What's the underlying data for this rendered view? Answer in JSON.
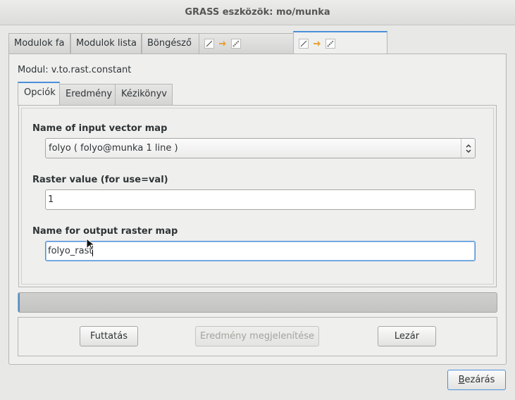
{
  "window": {
    "title": "GRASS eszközök: mo/munka"
  },
  "outer_tabs": [
    {
      "label": "Modulok fa"
    },
    {
      "label": "Modulok lista"
    },
    {
      "label": "Böngésző"
    }
  ],
  "module": {
    "label": "Modul: v.to.rast.constant"
  },
  "inner_tabs": [
    {
      "label": "Opciók"
    },
    {
      "label": "Eredmény"
    },
    {
      "label": "Kézikönyv"
    }
  ],
  "form": {
    "input_map": {
      "label": "Name of input vector map",
      "value": "folyo ( folyo@munka 1 line )"
    },
    "raster_value": {
      "label": "Raster value (for use=val)",
      "value": "1"
    },
    "output_map": {
      "label": "Name for output raster map",
      "value": "folyo_rast"
    }
  },
  "progress": {
    "value_percent": 0
  },
  "buttons": {
    "run": "Futtatás",
    "show_result": "Eredmény megjelenítése",
    "close_tab": "Lezár",
    "close_window_mnemonic": "B",
    "close_window_rest": "ezárás"
  },
  "colors": {
    "accent": "#4a90d9",
    "tab_icon_arrow": "#e8a33b"
  }
}
